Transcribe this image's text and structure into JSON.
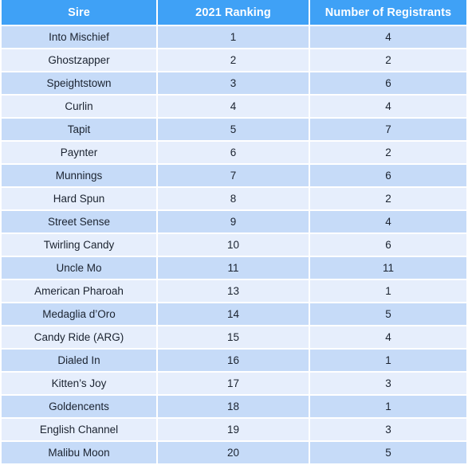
{
  "table": {
    "columns": [
      {
        "key": "sire",
        "label": "Sire"
      },
      {
        "key": "ranking",
        "label": "2021 Ranking"
      },
      {
        "key": "registrants",
        "label": "Number of Registrants"
      }
    ],
    "rows": [
      {
        "sire": "Into Mischief",
        "ranking": "1",
        "registrants": "4"
      },
      {
        "sire": "Ghostzapper",
        "ranking": "2",
        "registrants": "2"
      },
      {
        "sire": "Speightstown",
        "ranking": "3",
        "registrants": "6"
      },
      {
        "sire": "Curlin",
        "ranking": "4",
        "registrants": "4"
      },
      {
        "sire": "Tapit",
        "ranking": "5",
        "registrants": "7"
      },
      {
        "sire": "Paynter",
        "ranking": "6",
        "registrants": "2"
      },
      {
        "sire": "Munnings",
        "ranking": "7",
        "registrants": "6"
      },
      {
        "sire": "Hard Spun",
        "ranking": "8",
        "registrants": "2"
      },
      {
        "sire": "Street Sense",
        "ranking": "9",
        "registrants": "4"
      },
      {
        "sire": "Twirling Candy",
        "ranking": "10",
        "registrants": "6"
      },
      {
        "sire": "Uncle Mo",
        "ranking": "11",
        "registrants": "11"
      },
      {
        "sire": "American Pharoah",
        "ranking": "13",
        "registrants": "1"
      },
      {
        "sire": "Medaglia d’Oro",
        "ranking": "14",
        "registrants": "5"
      },
      {
        "sire": "Candy Ride (ARG)",
        "ranking": "15",
        "registrants": "4"
      },
      {
        "sire": "Dialed In",
        "ranking": "16",
        "registrants": "1"
      },
      {
        "sire": "Kitten’s Joy",
        "ranking": "17",
        "registrants": "3"
      },
      {
        "sire": "Goldencents",
        "ranking": "18",
        "registrants": "1"
      },
      {
        "sire": "English Channel",
        "ranking": "19",
        "registrants": "3"
      },
      {
        "sire": "Malibu Moon",
        "ranking": "20",
        "registrants": "5"
      }
    ]
  },
  "colors": {
    "header_background": "#3fa1f6",
    "header_text": "#ffffff",
    "row_dark": "#c6dbf8",
    "row_light": "#e6eefc",
    "cell_text": "#1b2330",
    "divider": "#ffffff"
  }
}
